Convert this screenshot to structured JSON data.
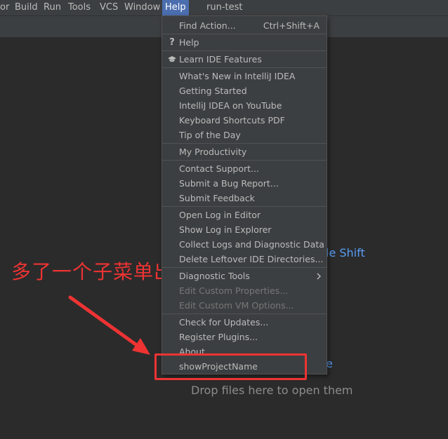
{
  "menubar": {
    "items": [
      "or",
      "Build",
      "Run",
      "Tools",
      "VCS",
      "Window",
      "Help"
    ],
    "project_title": "run-test"
  },
  "editor": {
    "hint_shift": "le Shift",
    "hint_e": "e",
    "drop_text": "Drop files here to open them"
  },
  "help_menu": {
    "find_action": "Find Action...",
    "find_action_shortcut": "Ctrl+Shift+A",
    "help": "Help",
    "learn_ide_features": "Learn IDE Features",
    "whats_new": "What's New in IntelliJ IDEA",
    "getting_started": "Getting Started",
    "youtube": "IntelliJ IDEA on YouTube",
    "keyboard_pdf": "Keyboard Shortcuts PDF",
    "tip_of_day": "Tip of the Day",
    "my_productivity": "My Productivity",
    "contact_support": "Contact Support...",
    "submit_bug": "Submit a Bug Report...",
    "submit_feedback": "Submit Feedback",
    "open_log": "Open Log in Editor",
    "show_log": "Show Log in Explorer",
    "collect_logs": "Collect Logs and Diagnostic Data",
    "delete_leftover": "Delete Leftover IDE Directories...",
    "diagnostic_tools": "Diagnostic Tools",
    "edit_properties": "Edit Custom Properties...",
    "edit_vm_options": "Edit Custom VM Options...",
    "check_updates": "Check for Updates...",
    "register_plugins": "Register Plugins...",
    "about": "About",
    "show_project_name": "showProjectName"
  },
  "annotation": {
    "text": "多了一个子菜单出来",
    "color": "#ee3333"
  },
  "colors": {
    "menu_bg": "#3c3f41",
    "editor_bg": "#2b2b2b",
    "active_menu": "#4b6eaf",
    "link": "#589df6"
  },
  "icons": [
    "question-icon",
    "graduation-cap-icon",
    "chevron-right-icon",
    "red-arrow-icon"
  ]
}
